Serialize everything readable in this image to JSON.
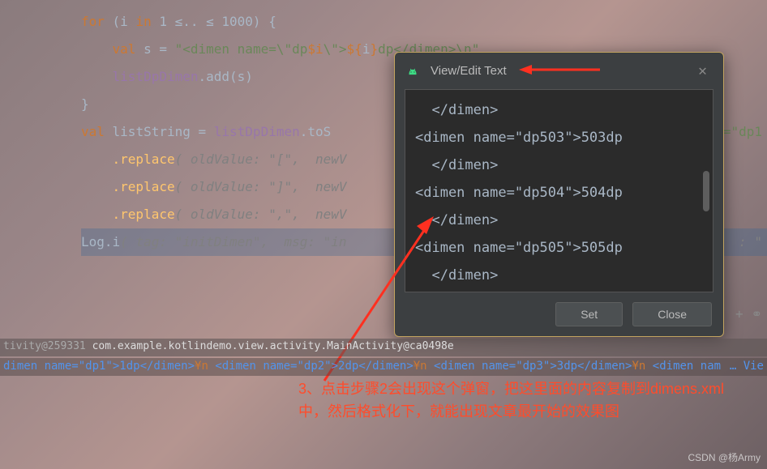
{
  "code": {
    "l1_for": "for",
    "l1_paren": " (i ",
    "l1_in": "in",
    "l1_range": " 1 ≤.. ≤ 1000) {",
    "l2_val": "val",
    "l2_s": " s = ",
    "l2_str1": "\"<dimen name=\\\"dp",
    "l2_tmpl1": "$i",
    "l2_str2": "\\\">",
    "l2_tmpl2": "${",
    "l2_tmpl_i": "i",
    "l2_tmpl3": "}",
    "l2_str3": "dp</dimen>\\n\"",
    "l3_listDp": "listDpDimen",
    "l3_add": ".add(s)",
    "l4_brace": "}",
    "l5_val": "val",
    "l5_listStr": " listString = ",
    "l5_listDp": "listDpDimen",
    "l5_toS": ".toS",
    "l5_tail": "=\"dp1",
    "l6_replace": ".replace",
    "l6_args": "( oldValue: \"[\",  newV",
    "l7_replace": ".replace",
    "l7_args": "( oldValue: \"]\",  newV",
    "l8_replace": ".replace",
    "l8_args": "( oldValue: \",\",  newV",
    "l9_log": "Log.i",
    "l9_tag": "( tag: \"initDimen\",  msg: \"in",
    "l9_tail": ": \""
  },
  "dialog": {
    "title": "View/Edit Text",
    "lines": [
      "  </dimen>",
      "<dimen name=\"dp503\">503dp",
      "  </dimen>",
      "<dimen name=\"dp504\">504dp",
      "  </dimen>",
      "<dimen name=\"dp505\">505dp",
      "  </dimen>"
    ],
    "set_btn": "Set",
    "close_btn": "Close"
  },
  "bottom": {
    "activity_prefix": "tivity@259331 ",
    "activity_main": "com.example.kotlindemo.view.activity.MainActivity@ca0498e"
  },
  "log": {
    "d1": "dimen name=\"dp1\">1dp</dimen>",
    "yn": "¥n ",
    "d2": "<dimen name=\"dp2\">2dp</dimen>",
    "d3": "<dimen name=\"dp3\">3dp</dimen>",
    "d4": "<dimen nam",
    "view": "… Vie"
  },
  "annotation": "3、点击步骤2会出现这个弹窗，把这里面的内容复制到dimens.xml中，然后格式化下，就能出现文章最开始的效果图",
  "watermark": "CSDN @杨Army"
}
